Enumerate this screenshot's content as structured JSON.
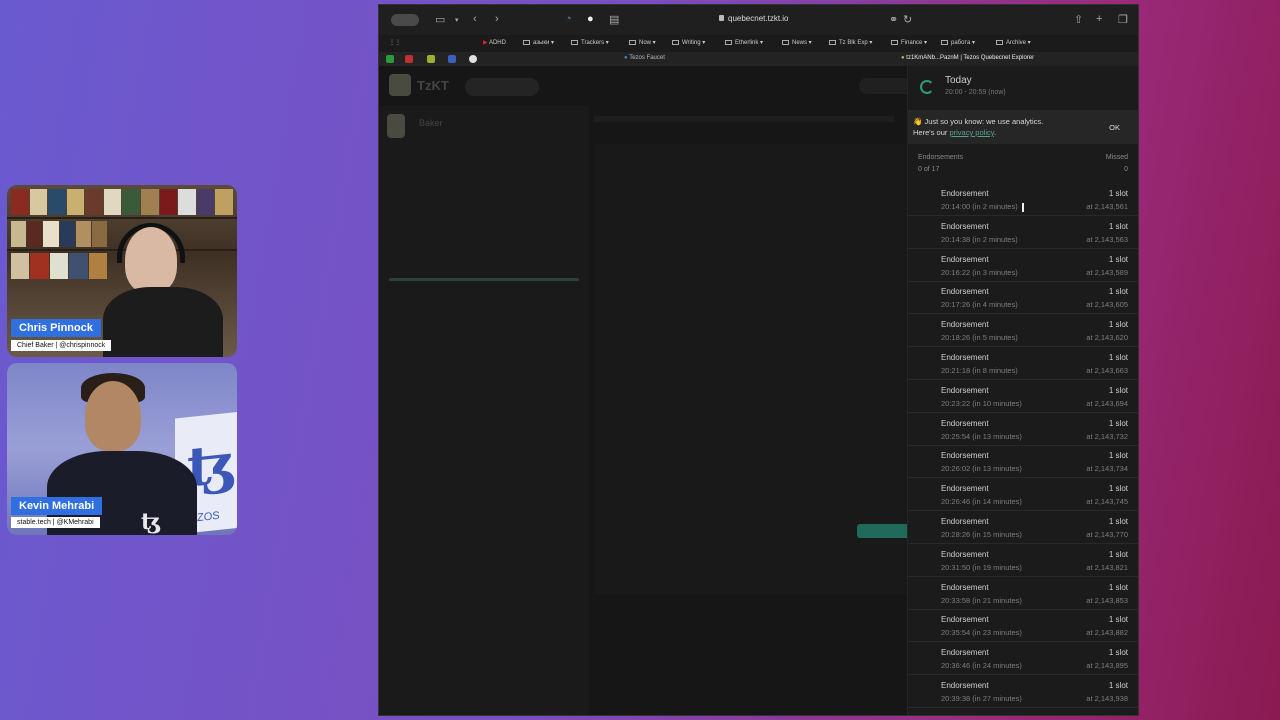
{
  "participants": [
    {
      "name": "Chris Pinnock",
      "subtitle": "Chief Baker | @chrispinnock"
    },
    {
      "name": "Kevin Mehrabi",
      "subtitle": "stable.tech | @KMehrabi"
    }
  ],
  "browser": {
    "url": "quebecnet.tzkt.io",
    "bookmarks": [
      "ADHD",
      "азыки",
      "Trackers",
      "Now",
      "Writing",
      "Etherlink",
      "News",
      "Tz Blk Exp",
      "Finance",
      "работа",
      "Archive"
    ],
    "tabs": [
      "Tezos Faucet",
      "tz1KmANb...PaznM | Tezos Quebecnet Explorer"
    ]
  },
  "page": {
    "brand": "TzKT",
    "role": "Baker"
  },
  "panel": {
    "title": "Today",
    "subtitle": "20:00 - 20:59 (now)",
    "notice_text": "Just so you know: we use analytics.",
    "notice_text2": "Here's our",
    "notice_link": "privacy policy",
    "notice_ok": "OK",
    "col_left": "Endorsements",
    "col_right": "Missed",
    "count_left": "0 of 17",
    "count_right": "0",
    "rows": [
      {
        "label": "Endorsement",
        "time": "20:14:00 (in 2 minutes)",
        "slot": "1 slot",
        "level": "at 2,143,561"
      },
      {
        "label": "Endorsement",
        "time": "20:14:38 (in 2 minutes)",
        "slot": "1 slot",
        "level": "at 2,143,563"
      },
      {
        "label": "Endorsement",
        "time": "20:16:22 (in 3 minutes)",
        "slot": "1 slot",
        "level": "at 2,143,589"
      },
      {
        "label": "Endorsement",
        "time": "20:17:26 (in 4 minutes)",
        "slot": "1 slot",
        "level": "at 2,143,605"
      },
      {
        "label": "Endorsement",
        "time": "20:18:26 (in 5 minutes)",
        "slot": "1 slot",
        "level": "at 2,143,620"
      },
      {
        "label": "Endorsement",
        "time": "20:21:18 (in 8 minutes)",
        "slot": "1 slot",
        "level": "at 2,143,663"
      },
      {
        "label": "Endorsement",
        "time": "20:23:22 (in 10 minutes)",
        "slot": "1 slot",
        "level": "at 2,143,694"
      },
      {
        "label": "Endorsement",
        "time": "20:25:54 (in 13 minutes)",
        "slot": "1 slot",
        "level": "at 2,143,732"
      },
      {
        "label": "Endorsement",
        "time": "20:26:02 (in 13 minutes)",
        "slot": "1 slot",
        "level": "at 2,143,734"
      },
      {
        "label": "Endorsement",
        "time": "20:26:46 (in 14 minutes)",
        "slot": "1 slot",
        "level": "at 2,143,745"
      },
      {
        "label": "Endorsement",
        "time": "20:28:26 (in 15 minutes)",
        "slot": "1 slot",
        "level": "at 2,143,770"
      },
      {
        "label": "Endorsement",
        "time": "20:31:50 (in 19 minutes)",
        "slot": "1 slot",
        "level": "at 2,143,821"
      },
      {
        "label": "Endorsement",
        "time": "20:33:58 (in 21 minutes)",
        "slot": "1 slot",
        "level": "at 2,143,853"
      },
      {
        "label": "Endorsement",
        "time": "20:35:54 (in 23 minutes)",
        "slot": "1 slot",
        "level": "at 2,143,882"
      },
      {
        "label": "Endorsement",
        "time": "20:36:46 (in 24 minutes)",
        "slot": "1 slot",
        "level": "at 2,143,895"
      },
      {
        "label": "Endorsement",
        "time": "20:39:38 (in 27 minutes)",
        "slot": "1 slot",
        "level": "at 2,143,938"
      }
    ]
  }
}
